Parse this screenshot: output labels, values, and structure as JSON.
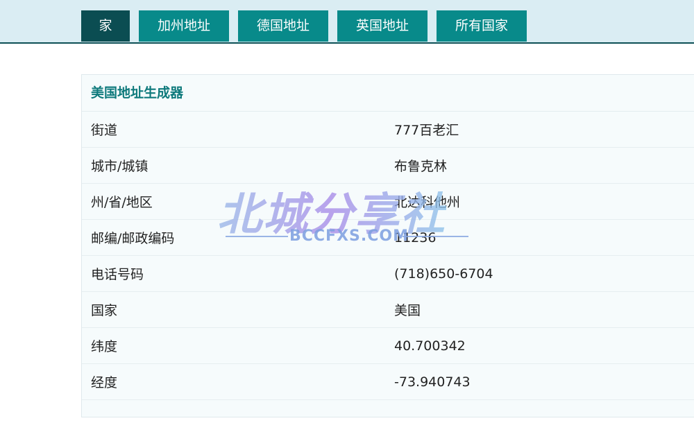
{
  "nav": {
    "tabs": [
      {
        "label": "家",
        "active": true
      },
      {
        "label": "加州地址",
        "active": false
      },
      {
        "label": "德国地址",
        "active": false
      },
      {
        "label": "英国地址",
        "active": false
      },
      {
        "label": "所有国家",
        "active": false
      }
    ]
  },
  "panel": {
    "title": "美国地址生成器",
    "rows": [
      {
        "label": "街道",
        "value": "777百老汇"
      },
      {
        "label": "城市/城镇",
        "value": "布鲁克林"
      },
      {
        "label": "州/省/地区",
        "value": "北达科他州"
      },
      {
        "label": "邮编/邮政编码",
        "value": "11236"
      },
      {
        "label": "电话号码",
        "value": "(718)650-6704"
      },
      {
        "label": "国家",
        "value": "美国"
      },
      {
        "label": "纬度",
        "value": "40.700342"
      },
      {
        "label": "经度",
        "value": "-73.940743"
      }
    ]
  },
  "watermark": {
    "title": "北城分享社",
    "subtitle": "BCCFXS.COM"
  },
  "colors": {
    "tab_bg": "#088a8a",
    "tab_active_bg": "#0b4d52",
    "topbar_bg": "#daedf3",
    "title_color": "#0f7a7c"
  }
}
